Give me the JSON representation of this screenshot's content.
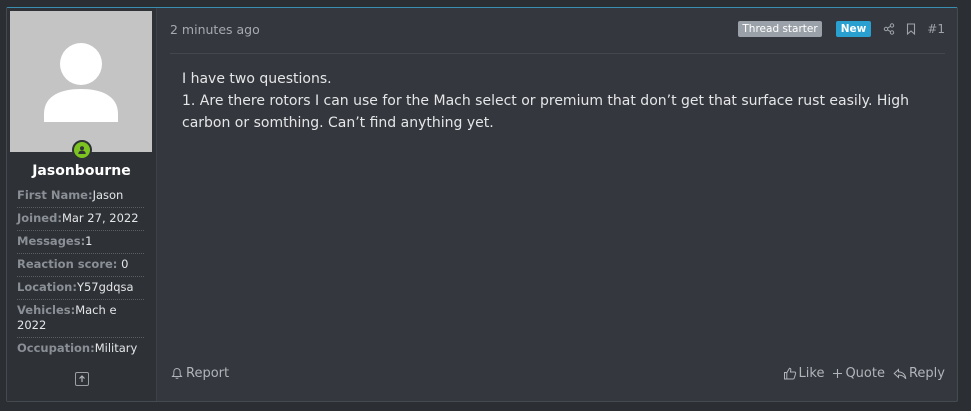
{
  "post": {
    "time": "2 minutes ago",
    "badges": {
      "thread_starter": "Thread starter",
      "new": "New"
    },
    "post_number": "#1",
    "body_lines": [
      "I have two questions.",
      "1. Are there rotors I can use for the Mach select or premium that don’t get that surface rust easily. High carbon or somthing. Can’t find anything yet."
    ]
  },
  "user": {
    "username": "Jasonbourne",
    "info": [
      {
        "label": "First Name:",
        "value": "Jason"
      },
      {
        "label": "Joined:",
        "value": "Mar 27, 2022"
      },
      {
        "label": "Messages:",
        "value": "1"
      },
      {
        "label": "Reaction score:",
        "value": "0"
      },
      {
        "label": "Location:",
        "value": "Y57gdqsa"
      },
      {
        "label": "Vehicles:",
        "value": "Mach e 2022"
      },
      {
        "label": "Occupation:",
        "value": "Military"
      }
    ]
  },
  "actions": {
    "report": "Report",
    "like": "Like",
    "quote": "Quote",
    "reply": "Reply"
  },
  "colors": {
    "accent": "#2aa0d0",
    "online": "#7cc220",
    "background": "#34373d"
  }
}
